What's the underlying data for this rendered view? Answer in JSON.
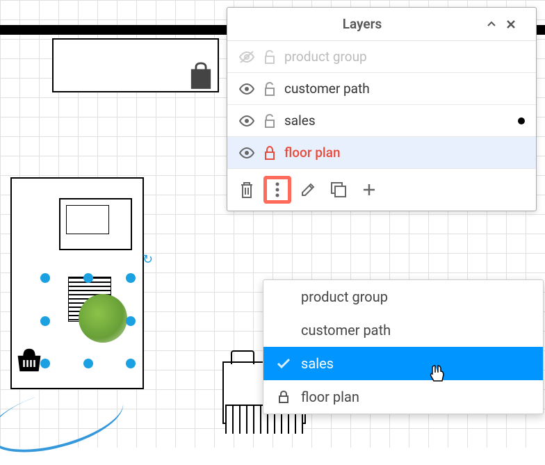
{
  "panel": {
    "title": "Layers",
    "layers": [
      {
        "name": "product group",
        "visible": false,
        "locked": false
      },
      {
        "name": "customer path",
        "visible": true,
        "locked": false
      },
      {
        "name": "sales",
        "visible": true,
        "locked": false,
        "hasDot": true
      },
      {
        "name": "floor plan",
        "visible": true,
        "locked": true
      }
    ]
  },
  "contextMenu": {
    "items": [
      {
        "name": "product group"
      },
      {
        "name": "customer path"
      },
      {
        "name": "sales",
        "selected": true
      },
      {
        "name": "floor plan",
        "locked": true
      }
    ]
  },
  "colors": {
    "accent": "#0095ff",
    "highlight": "#ff6b5b",
    "locked": "#e74c3c",
    "selection": "#1ba1e2"
  }
}
